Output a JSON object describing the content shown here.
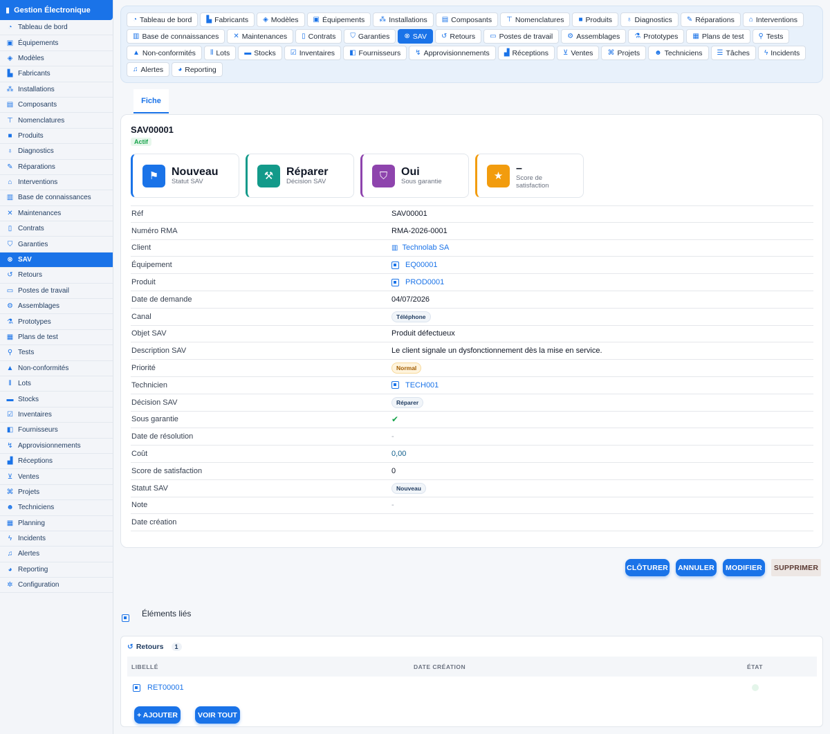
{
  "app": {
    "title": "Gestion Électronique"
  },
  "sidebar": {
    "items": [
      {
        "label": "Tableau de bord",
        "icon": "gauge-icon",
        "glyph": "◔"
      },
      {
        "label": "Équipements",
        "icon": "chip-icon",
        "glyph": "▣"
      },
      {
        "label": "Modèles",
        "icon": "cube-icon",
        "glyph": "◈"
      },
      {
        "label": "Fabricants",
        "icon": "factory-icon",
        "glyph": "▙"
      },
      {
        "label": "Installations",
        "icon": "network-icon",
        "glyph": "⁂"
      },
      {
        "label": "Composants",
        "icon": "memory-icon",
        "glyph": "▤"
      },
      {
        "label": "Nomenclatures",
        "icon": "sitemap-icon",
        "glyph": "⊤"
      },
      {
        "label": "Produits",
        "icon": "box-icon",
        "glyph": "■"
      },
      {
        "label": "Diagnostics",
        "icon": "stethoscope-icon",
        "glyph": "♁"
      },
      {
        "label": "Réparations",
        "icon": "wrench-icon",
        "glyph": "✎"
      },
      {
        "label": "Interventions",
        "icon": "helmet-icon",
        "glyph": "⌂"
      },
      {
        "label": "Base de connaissances",
        "icon": "book-icon",
        "glyph": "▥"
      },
      {
        "label": "Maintenances",
        "icon": "tools-icon",
        "glyph": "✕"
      },
      {
        "label": "Contrats",
        "icon": "file-contract-icon",
        "glyph": "▯"
      },
      {
        "label": "Garanties",
        "icon": "shield-icon",
        "glyph": "⛉"
      },
      {
        "label": "SAV",
        "icon": "life-ring-icon",
        "glyph": "⊗"
      },
      {
        "label": "Retours",
        "icon": "undo-icon",
        "glyph": "↺"
      },
      {
        "label": "Postes de travail",
        "icon": "desktop-icon",
        "glyph": "▭"
      },
      {
        "label": "Assemblages",
        "icon": "cogs-icon",
        "glyph": "⚙"
      },
      {
        "label": "Prototypes",
        "icon": "flask-icon",
        "glyph": "⚗"
      },
      {
        "label": "Plans de test",
        "icon": "clipboard-icon",
        "glyph": "▦"
      },
      {
        "label": "Tests",
        "icon": "vial-icon",
        "glyph": "⚲"
      },
      {
        "label": "Non-conformités",
        "icon": "warning-icon",
        "glyph": "▲"
      },
      {
        "label": "Lots",
        "icon": "barcode-icon",
        "glyph": "⦀"
      },
      {
        "label": "Stocks",
        "icon": "warehouse-icon",
        "glyph": "▬"
      },
      {
        "label": "Inventaires",
        "icon": "clipboard-check-icon",
        "glyph": "☑"
      },
      {
        "label": "Fournisseurs",
        "icon": "truck-icon",
        "glyph": "◧"
      },
      {
        "label": "Approvisionnements",
        "icon": "dolly-icon",
        "glyph": "↯"
      },
      {
        "label": "Réceptions",
        "icon": "truck-loading-icon",
        "glyph": "▟"
      },
      {
        "label": "Ventes",
        "icon": "cart-icon",
        "glyph": "⊻"
      },
      {
        "label": "Projets",
        "icon": "project-diagram-icon",
        "glyph": "⌘"
      },
      {
        "label": "Techniciens",
        "icon": "user-cog-icon",
        "glyph": "☻"
      },
      {
        "label": "Planning",
        "icon": "calendar-icon",
        "glyph": "▦"
      },
      {
        "label": "Incidents",
        "icon": "bolt-icon",
        "glyph": "ϟ"
      },
      {
        "label": "Alertes",
        "icon": "bell-icon",
        "glyph": "♫"
      },
      {
        "label": "Reporting",
        "icon": "chart-pie-icon",
        "glyph": "◕"
      },
      {
        "label": "Configuration",
        "icon": "gear-icon",
        "glyph": "✲"
      }
    ],
    "active": "SAV"
  },
  "tabs": [
    {
      "label": "Tableau de bord",
      "icon": "gauge-icon",
      "glyph": "◔"
    },
    {
      "label": "Fabricants",
      "icon": "factory-icon",
      "glyph": "▙"
    },
    {
      "label": "Modèles",
      "icon": "cube-icon",
      "glyph": "◈"
    },
    {
      "label": "Équipements",
      "icon": "chip-icon",
      "glyph": "▣"
    },
    {
      "label": "Installations",
      "icon": "network-icon",
      "glyph": "⁂"
    },
    {
      "label": "Composants",
      "icon": "memory-icon",
      "glyph": "▤"
    },
    {
      "label": "Nomenclatures",
      "icon": "sitemap-icon",
      "glyph": "⊤"
    },
    {
      "label": "Produits",
      "icon": "box-icon",
      "glyph": "■"
    },
    {
      "label": "Diagnostics",
      "icon": "stethoscope-icon",
      "glyph": "♁"
    },
    {
      "label": "Réparations",
      "icon": "wrench-icon",
      "glyph": "✎"
    },
    {
      "label": "Interventions",
      "icon": "helmet-icon",
      "glyph": "⌂"
    },
    {
      "label": "Base de connaissances",
      "icon": "book-icon",
      "glyph": "▥"
    },
    {
      "label": "Maintenances",
      "icon": "tools-icon",
      "glyph": "✕"
    },
    {
      "label": "Contrats",
      "icon": "file-contract-icon",
      "glyph": "▯"
    },
    {
      "label": "Garanties",
      "icon": "shield-icon",
      "glyph": "⛉"
    },
    {
      "label": "SAV",
      "icon": "life-ring-icon",
      "glyph": "⊗"
    },
    {
      "label": "Retours",
      "icon": "undo-icon",
      "glyph": "↺"
    },
    {
      "label": "Postes de travail",
      "icon": "desktop-icon",
      "glyph": "▭"
    },
    {
      "label": "Assemblages",
      "icon": "cogs-icon",
      "glyph": "⚙"
    },
    {
      "label": "Prototypes",
      "icon": "flask-icon",
      "glyph": "⚗"
    },
    {
      "label": "Plans de test",
      "icon": "clipboard-icon",
      "glyph": "▦"
    },
    {
      "label": "Tests",
      "icon": "vial-icon",
      "glyph": "⚲"
    },
    {
      "label": "Non-conformités",
      "icon": "warning-icon",
      "glyph": "▲"
    },
    {
      "label": "Lots",
      "icon": "barcode-icon",
      "glyph": "⦀"
    },
    {
      "label": "Stocks",
      "icon": "warehouse-icon",
      "glyph": "▬"
    },
    {
      "label": "Inventaires",
      "icon": "clipboard-check-icon",
      "glyph": "☑"
    },
    {
      "label": "Fournisseurs",
      "icon": "truck-icon",
      "glyph": "◧"
    },
    {
      "label": "Approvisionnements",
      "icon": "dolly-icon",
      "glyph": "↯"
    },
    {
      "label": "Réceptions",
      "icon": "truck-loading-icon",
      "glyph": "▟"
    },
    {
      "label": "Ventes",
      "icon": "cart-icon",
      "glyph": "⊻"
    },
    {
      "label": "Projets",
      "icon": "project-diagram-icon",
      "glyph": "⌘"
    },
    {
      "label": "Techniciens",
      "icon": "user-cog-icon",
      "glyph": "☻"
    },
    {
      "label": "Tâches",
      "icon": "tasks-icon",
      "glyph": "☰"
    },
    {
      "label": "Incidents",
      "icon": "bolt-icon",
      "glyph": "ϟ"
    },
    {
      "label": "Alertes",
      "icon": "bell-icon",
      "glyph": "♫"
    },
    {
      "label": "Reporting",
      "icon": "chart-pie-icon",
      "glyph": "◕"
    }
  ],
  "active_tab": "SAV",
  "view": {
    "fiche_tab": "Fiche"
  },
  "record": {
    "ref": "SAV00001",
    "status_badge": "Actif",
    "kpis": [
      {
        "value": "Nouveau",
        "label": "Statut SAV",
        "icon": "flag-icon",
        "glyph": "⚑",
        "color": "#1a73e8"
      },
      {
        "value": "Réparer",
        "label": "Décision SAV",
        "icon": "hammer-icon",
        "glyph": "⚒",
        "color": "#139a8a"
      },
      {
        "value": "Oui",
        "label": "Sous garantie",
        "icon": "shield-icon",
        "glyph": "⛉",
        "color": "#8e44ad"
      },
      {
        "value": "–",
        "label": "Score de satisfaction",
        "icon": "star-icon",
        "glyph": "★",
        "color": "#f29c0e"
      }
    ],
    "fields": [
      {
        "label": "Réf",
        "value": "SAV00001",
        "type": "text"
      },
      {
        "label": "Numéro RMA",
        "value": "RMA-2026-0001",
        "type": "text"
      },
      {
        "label": "Client",
        "value": "Technolab SA",
        "type": "link-building"
      },
      {
        "label": "Équipement",
        "value": "EQ00001",
        "type": "link-chip"
      },
      {
        "label": "Produit",
        "value": "PROD0001",
        "type": "link-chip"
      },
      {
        "label": "Date de demande",
        "value": "04/07/2026",
        "type": "text"
      },
      {
        "label": "Canal",
        "value": "Téléphone",
        "type": "pill"
      },
      {
        "label": "Objet SAV",
        "value": "Produit défectueux",
        "type": "text"
      },
      {
        "label": "Description SAV",
        "value": "Le client signale un dysfonctionnement dès la mise en service.",
        "type": "text"
      },
      {
        "label": "Priorité",
        "value": "Normal",
        "type": "pill-warn"
      },
      {
        "label": "Technicien",
        "value": "TECH001",
        "type": "link-chip"
      },
      {
        "label": "Décision SAV",
        "value": "Réparer",
        "type": "pill"
      },
      {
        "label": "Sous garantie",
        "value": "✔",
        "type": "check"
      },
      {
        "label": "Date de résolution",
        "value": "-",
        "type": "muted"
      },
      {
        "label": "Coût",
        "value": "0,00",
        "type": "money"
      },
      {
        "label": "Score de satisfaction",
        "value": "0",
        "type": "text"
      },
      {
        "label": "Statut SAV",
        "value": "Nouveau",
        "type": "pill"
      },
      {
        "label": "Note",
        "value": "-",
        "type": "muted"
      },
      {
        "label": "Date création",
        "value": "",
        "type": "text"
      }
    ]
  },
  "actions": {
    "close_label": "CLÔTURER",
    "cancel_label": "ANNULER",
    "edit_label": "MODIFIER",
    "delete_label": "SUPPRIMER"
  },
  "linked": {
    "title": "Éléments liés",
    "retours": {
      "title": "Retours",
      "count": "1",
      "columns": [
        "LIBELLÉ",
        "DATE CRÉATION",
        "ÉTAT"
      ],
      "rows": [
        {
          "libelle": "RET00001",
          "date": "",
          "etat": ""
        }
      ],
      "add_label": "+ AJOUTER",
      "view_all_label": "VOIR TOUT"
    }
  },
  "colors": {
    "accent": "#1a73e8",
    "success": "#16a34a",
    "warning": "#f29c0e"
  }
}
